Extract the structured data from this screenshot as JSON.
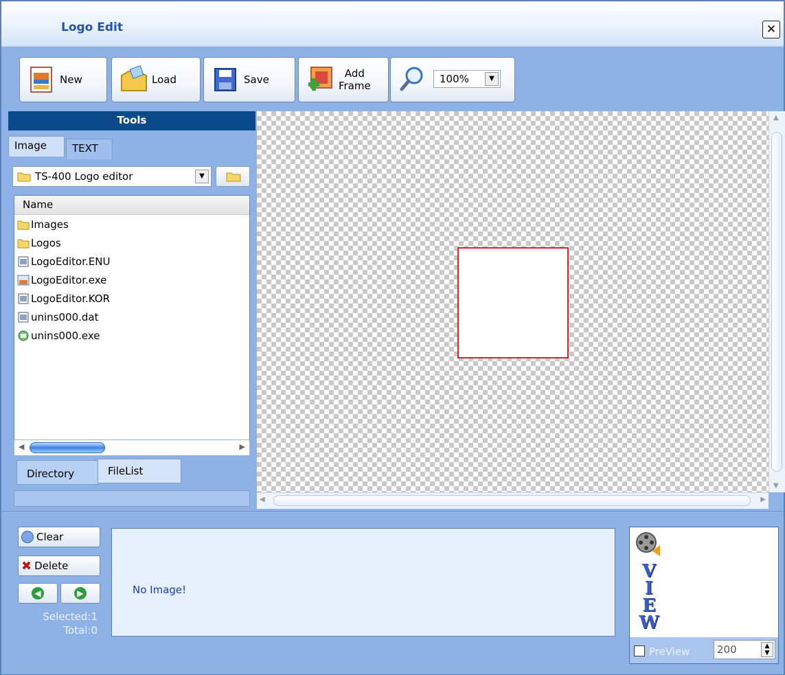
{
  "window": {
    "title": "Logo Edit",
    "close_glyph": "✕"
  },
  "toolbar": {
    "new_label": "New",
    "load_label": "Load",
    "save_label": "Save",
    "add_frame_line1": "Add",
    "add_frame_line2": "Frame",
    "zoom_value": "100%"
  },
  "tools": {
    "header": "Tools",
    "tabs": [
      "Image",
      "TEXT"
    ],
    "folder": "TS-400 Logo editor",
    "list_header": "Name",
    "files": [
      {
        "name": "Images",
        "icon": "folder-icon"
      },
      {
        "name": "Logos",
        "icon": "folder-icon"
      },
      {
        "name": "LogoEditor.ENU",
        "icon": "file-icon"
      },
      {
        "name": "LogoEditor.exe",
        "icon": "exe-icon"
      },
      {
        "name": "LogoEditor.KOR",
        "icon": "file-icon"
      },
      {
        "name": "unins000.dat",
        "icon": "file-icon"
      },
      {
        "name": "unins000.exe",
        "icon": "installer-icon"
      }
    ],
    "bottom_tabs": [
      "Directory",
      "FileList"
    ]
  },
  "frames": {
    "clear_label": "Clear",
    "delete_label": "Delete",
    "selected": "Selected:1",
    "total": "Total:0",
    "empty_text": "No Image!"
  },
  "preview": {
    "label": "PreView",
    "value": "200",
    "view_letters": [
      "V",
      "I",
      "E",
      "W"
    ]
  },
  "colors": {
    "accent": "#2352b5",
    "panel_bg": "#8eb2e6",
    "tools_header": "#0b4a8b",
    "frame_border": "#dd2222"
  }
}
